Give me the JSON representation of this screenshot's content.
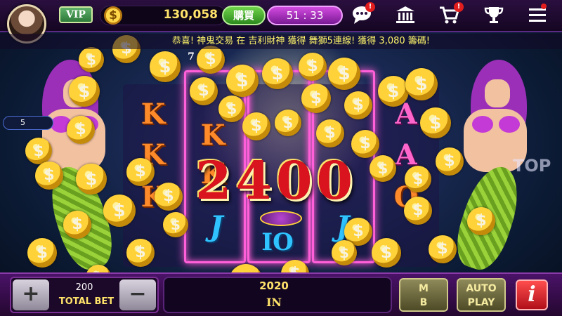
{
  "header": {
    "vip_label": "VIP",
    "coin_symbol": "$",
    "balance": "130,058",
    "buy_label": "購買",
    "timer": "51 : 33",
    "chat_badge": "!",
    "cart_badge": "!"
  },
  "ticker": {
    "message": "恭喜! 神鬼交易 在 吉利財神 獲得 舞獅5連線! 獲得 3,080 籌碼!"
  },
  "reels": {
    "symbols": [
      "K",
      "K",
      "K",
      "K",
      "K",
      "J",
      "J",
      "IO",
      "A",
      "A",
      "Q",
      "7"
    ],
    "line_count": "5"
  },
  "win": {
    "amount_display": "2400",
    "stop_label": "TOP"
  },
  "footer": {
    "minus": "−",
    "plus": "+",
    "bet_value": "200",
    "bet_label": "TOTAL BET",
    "win_value": "2020",
    "win_label": "IN",
    "max_bet_label": "M\nB",
    "auto_play_label": "AUTO\nPLAY",
    "info_label": "i"
  },
  "colors": {
    "accent_gold": "#ffe36a",
    "buy_green": "#3fae2c",
    "timer_purple": "#a52fc0",
    "reel_glow": "#ff5fd8",
    "win_red": "#d9141e"
  },
  "icons": {
    "chat": "chat-icon",
    "bank": "bank-icon",
    "cart": "cart-icon",
    "trophy": "trophy-icon",
    "menu": "menu-icon"
  }
}
